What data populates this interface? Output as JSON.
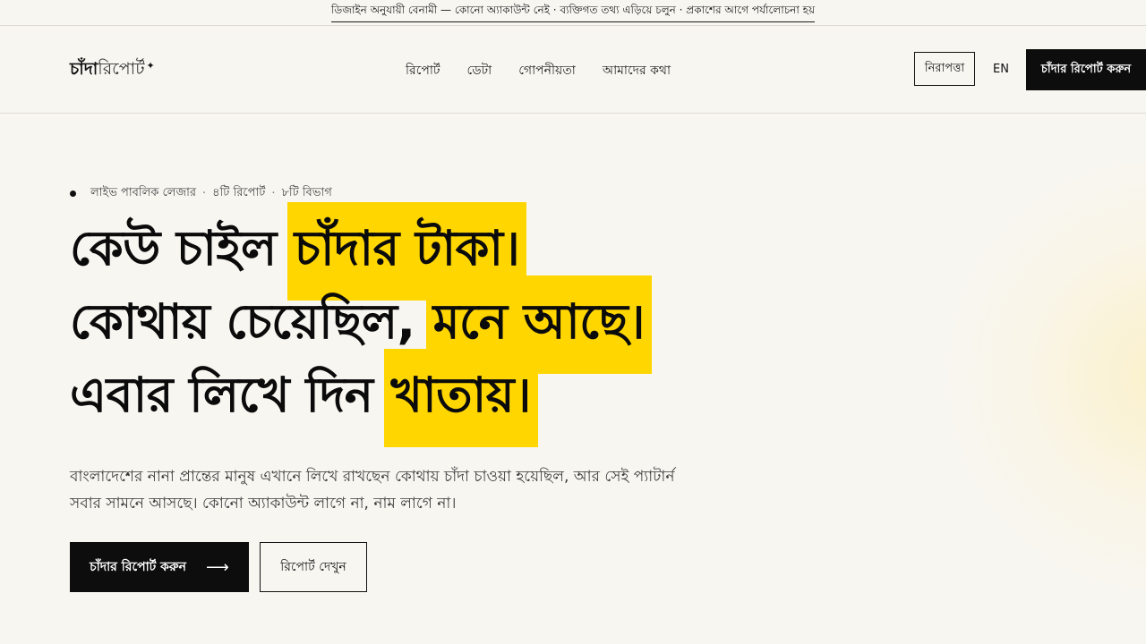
{
  "notice": {
    "text": "ডিজাইন অনুযায়ী বেনামী — কোনো অ্যাকাউন্ট নেই · ব্যক্তিগত তথ্য এড়িয়ে চলুন · প্রকাশের আগে পর্যালোচনা হয়"
  },
  "header": {
    "logo_bold": "চাঁদা",
    "logo_light": "রিপোর্ট",
    "logo_star": "✦",
    "nav": [
      "রিপোর্ট",
      "ডেটা",
      "গোপনীয়তা",
      "আমাদের কথা"
    ],
    "safety_label": "নিরাপত্তা",
    "lang_label": "EN",
    "report_label": "চাঁদার রিপোর্ট করুন"
  },
  "hero": {
    "ledger_items": [
      "লাইভ পাবলিক লেজার",
      "৪টি রিপোর্ট",
      "৮টি বিভাগ"
    ],
    "ledger_sep": "·",
    "line1_plain": "কেউ চাইল",
    "line1_mark": "চাঁদার টাকা।",
    "line2_plain": "কোথায় চেয়েছিল,",
    "line2_mark": "মনে আছে।",
    "line3_plain": "এবার লিখে দিন",
    "line3_mark": "খাতায়।",
    "subtext": "বাংলাদেশের নানা প্রান্তের মানুষ এখানে লিখে রাখছেন কোথায় চাঁদা চাওয়া হয়েছিল, আর সেই প্যাটার্ন সবার সামনে আসছে। কোনো অ্যাকাউন্ট লাগে না, নাম লাগে না।",
    "cta_primary": "চাঁদার রিপোর্ট করুন",
    "cta_arrow": "⟶",
    "cta_secondary": "রিপোর্ট দেখুন"
  },
  "colors": {
    "background": "#f8f6f1",
    "highlight": "#ffd600",
    "primary_button": "#0d0d0d"
  }
}
